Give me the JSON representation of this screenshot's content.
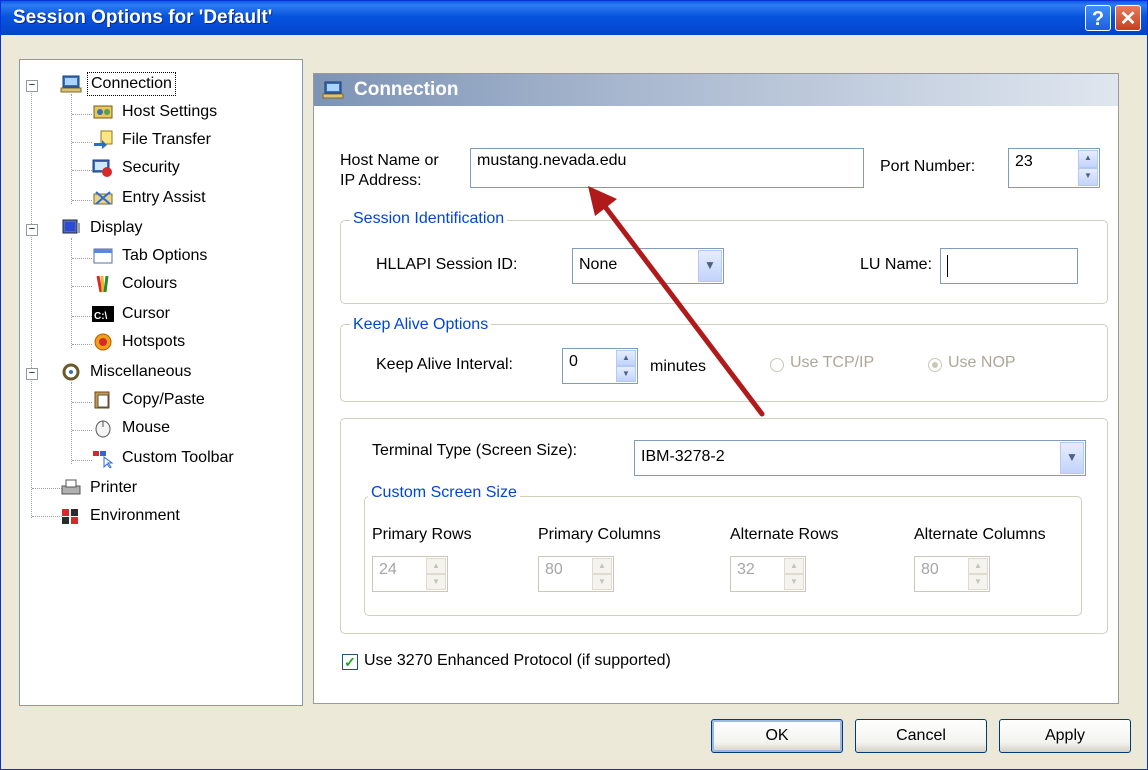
{
  "window": {
    "title": "Session Options for 'Default'",
    "help_button": "?",
    "close_button": "✕"
  },
  "tree": {
    "items": [
      {
        "label": "Connection",
        "icon": "connection-icon",
        "expander": "−"
      },
      {
        "label": "Host Settings",
        "icon": "host-settings-icon"
      },
      {
        "label": "File Transfer",
        "icon": "file-transfer-icon"
      },
      {
        "label": "Security",
        "icon": "security-icon"
      },
      {
        "label": "Entry Assist",
        "icon": "entry-assist-icon"
      },
      {
        "label": "Display",
        "icon": "display-icon",
        "expander": "−"
      },
      {
        "label": "Tab Options",
        "icon": "tab-options-icon"
      },
      {
        "label": "Colours",
        "icon": "colours-icon"
      },
      {
        "label": "Cursor",
        "icon": "cursor-icon",
        "icon_text": "C:\\"
      },
      {
        "label": "Hotspots",
        "icon": "hotspots-icon"
      },
      {
        "label": "Miscellaneous",
        "icon": "miscellaneous-icon",
        "expander": "−"
      },
      {
        "label": "Copy/Paste",
        "icon": "copy-paste-icon"
      },
      {
        "label": "Mouse",
        "icon": "mouse-icon"
      },
      {
        "label": "Custom Toolbar",
        "icon": "custom-toolbar-icon"
      },
      {
        "label": "Printer",
        "icon": "printer-icon"
      },
      {
        "label": "Environment",
        "icon": "environment-icon"
      }
    ]
  },
  "panel": {
    "title": "Connection",
    "host": {
      "label_line1": "Host Name or",
      "label_line2": "IP Address:",
      "value": "mustang.nevada.edu"
    },
    "port": {
      "label": "Port Number:",
      "value": "23"
    },
    "session_identification": {
      "title": "Session Identification",
      "hllapi_label": "HLLAPI Session ID:",
      "hllapi_value": "None",
      "lu_label": "LU Name:",
      "lu_value": ""
    },
    "keep_alive": {
      "title": "Keep Alive Options",
      "interval_label": "Keep Alive Interval:",
      "interval_value": "0",
      "minutes_label": "minutes",
      "tcp_label": "Use TCP/IP",
      "nop_label": "Use NOP",
      "selected": "Use NOP"
    },
    "terminal": {
      "label": "Terminal Type (Screen Size):",
      "value": "IBM-3278-2"
    },
    "custom_screen": {
      "title": "Custom Screen Size",
      "fields": [
        {
          "label": "Primary Rows",
          "value": "24"
        },
        {
          "label": "Primary Columns",
          "value": "80"
        },
        {
          "label": "Alternate Rows",
          "value": "32"
        },
        {
          "label": "Alternate Columns",
          "value": "80"
        }
      ]
    },
    "enhanced_protocol": {
      "label": "Use 3270 Enhanced Protocol (if supported)",
      "checked": true
    }
  },
  "buttons": {
    "ok": "OK",
    "cancel": "Cancel",
    "apply": "Apply"
  },
  "colors": {
    "title_bar": "#0754de",
    "group_title": "#0046d5",
    "annotation_arrow": "#b01a1a"
  }
}
